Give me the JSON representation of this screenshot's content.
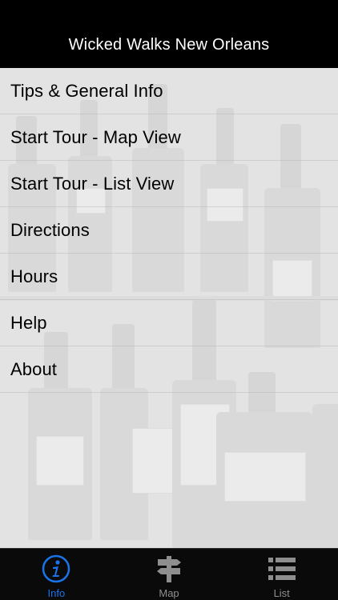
{
  "nav": {
    "title": "Wicked Walks New Orleans"
  },
  "menu": {
    "items": [
      {
        "label": "Tips & General Info"
      },
      {
        "label": "Start Tour - Map View"
      },
      {
        "label": "Start Tour - List View"
      },
      {
        "label": "Directions"
      },
      {
        "label": "Hours"
      },
      {
        "label": "Help"
      },
      {
        "label": "About"
      }
    ]
  },
  "tabbar": {
    "active_color": "#1a73e8",
    "inactive_color": "#8e8e8e",
    "tabs": [
      {
        "label": "Info",
        "icon": "info-icon",
        "active": true
      },
      {
        "label": "Map",
        "icon": "signpost-icon",
        "active": false
      },
      {
        "label": "List",
        "icon": "list-icon",
        "active": false
      }
    ]
  }
}
